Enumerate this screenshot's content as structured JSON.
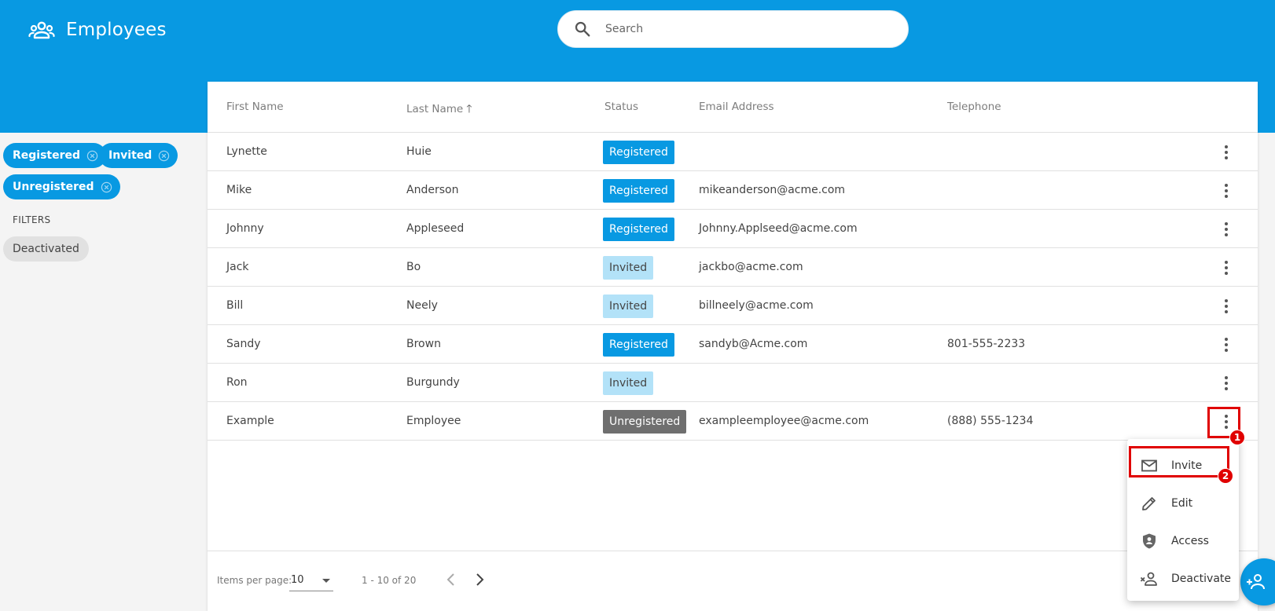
{
  "header": {
    "title": "Employees",
    "icon": "people-icon",
    "search_placeholder": "Search",
    "search_value": ""
  },
  "sidebar": {
    "active_chips": [
      {
        "label": "Registered"
      },
      {
        "label": "Invited"
      },
      {
        "label": "Unregistered"
      }
    ],
    "filters_label": "FILTERS",
    "filter_options": [
      {
        "label": "Deactivated"
      }
    ]
  },
  "table": {
    "columns": [
      "First Name",
      "Last Name",
      "Status",
      "Email Address",
      "Telephone"
    ],
    "sorted_column": "Last Name",
    "sort_direction": "ascending",
    "rows": [
      {
        "first": "Lynette",
        "last": "Huie",
        "status": "Registered",
        "email": "",
        "phone": ""
      },
      {
        "first": "Mike",
        "last": "Anderson",
        "status": "Registered",
        "email": "mikeanderson@acme.com",
        "phone": ""
      },
      {
        "first": "Johnny",
        "last": "Appleseed",
        "status": "Registered",
        "email": "Johnny.Applseed@acme.com",
        "phone": ""
      },
      {
        "first": "Jack",
        "last": "Bo",
        "status": "Invited",
        "email": "jackbo@acme.com",
        "phone": ""
      },
      {
        "first": "Bill",
        "last": "Neely",
        "status": "Invited",
        "email": "billneely@acme.com",
        "phone": ""
      },
      {
        "first": "Sandy",
        "last": "Brown",
        "status": "Registered",
        "email": "sandyb@Acme.com",
        "phone": "801-555-2233"
      },
      {
        "first": "Ron",
        "last": "Burgundy",
        "status": "Invited",
        "email": "",
        "phone": ""
      },
      {
        "first": "Example",
        "last": "Employee",
        "status": "Unregistered",
        "email": "exampleemployee@acme.com",
        "phone": "(888) 555-1234"
      }
    ]
  },
  "paginator": {
    "items_per_page_label": "Items per page:",
    "items_per_page_value": "10",
    "range_label": "1 - 10 of 20"
  },
  "context_menu": {
    "items": [
      {
        "label": "Invite",
        "icon": "mail-icon"
      },
      {
        "label": "Edit",
        "icon": "pencil-icon"
      },
      {
        "label": "Access",
        "icon": "shield-person-icon"
      },
      {
        "label": "Deactivate",
        "icon": "remove-person-icon"
      }
    ]
  },
  "annotations": {
    "markers": [
      "1",
      "2"
    ],
    "color": "#e00000"
  },
  "colors": {
    "primary": "#0899e2",
    "invited_badge": "#b3e2f8",
    "unregistered_badge": "#6f6f6f"
  }
}
